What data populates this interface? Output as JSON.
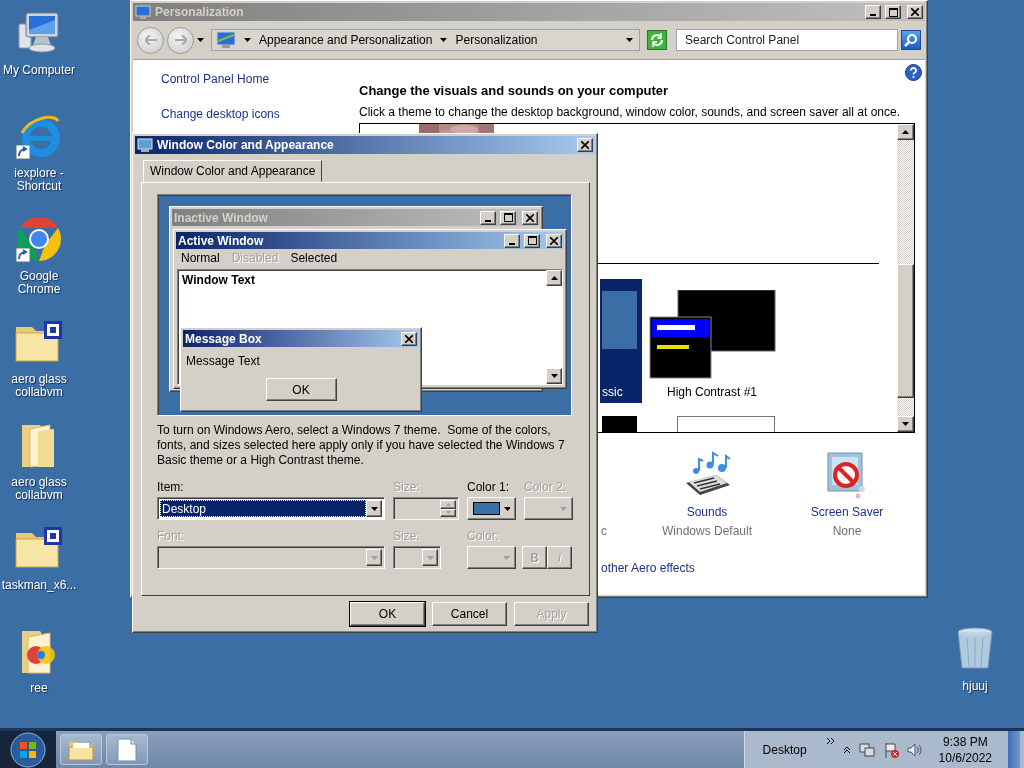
{
  "desktop_icons": [
    {
      "label": "My Computer",
      "kind": "computer",
      "shortcut": false
    },
    {
      "label": "iexplore - Shortcut",
      "kind": "browser_e",
      "shortcut": true
    },
    {
      "label": "Google Chrome",
      "kind": "browser_ring",
      "shortcut": true
    },
    {
      "label": "aero glass collabvm",
      "kind": "archive_seven",
      "shortcut": false
    },
    {
      "label": "aero glass collabvm",
      "kind": "folder",
      "shortcut": false
    },
    {
      "label": "taskman_x6...",
      "kind": "archive_zip",
      "shortcut": false
    },
    {
      "label": "ree",
      "kind": "folder_media",
      "shortcut": false
    }
  ],
  "recycle_bin": {
    "label": "hjuuj"
  },
  "personalization": {
    "title": "Personalization",
    "active": false,
    "breadcrumbs": [
      "Appearance and Personalization",
      "Personalization"
    ],
    "search": {
      "placeholder": "Search Control Panel"
    },
    "sidebar": [
      "Control Panel Home",
      "Change desktop icons"
    ],
    "heading": "Change the visuals and sounds on your computer",
    "description": "Click a theme to change the desktop background, window color, sounds, and screen saver all at once.",
    "themes": [
      {
        "label": "ssic",
        "kind": "classic",
        "selected": true
      },
      {
        "label": "High Contrast #1",
        "kind": "high_contrast",
        "selected": false
      }
    ],
    "settings": [
      {
        "kind": "window_color",
        "subtitle": "c"
      },
      {
        "kind": "sounds",
        "title": "Sounds",
        "subtitle": "Windows Default"
      },
      {
        "kind": "screen_saver",
        "title": "Screen Saver",
        "subtitle": "None"
      }
    ],
    "link": "other Aero effects"
  },
  "dialog": {
    "title": "Window Color and Appearance",
    "active": true,
    "tabs": [
      {
        "label": "Window Color and Appearance",
        "selected": true
      }
    ],
    "preview": {
      "inactive_title": "Inactive Window",
      "active_title": "Active Window",
      "menu": [
        {
          "label": "Normal",
          "disabled": false
        },
        {
          "label": "Disabled",
          "disabled": true
        },
        {
          "label": "Selected",
          "disabled": false
        }
      ],
      "window_text": "Window Text",
      "message_box": {
        "title": "Message Box",
        "text": "Message Text",
        "button": "OK"
      }
    },
    "note": "To turn on Windows Aero, select a Windows 7 theme.  Some of the colors, fonts, and sizes selected here apply only if you have selected the Windows 7 Basic theme or a High Contrast theme.",
    "item_row": [
      {
        "kind": "select",
        "label": "Item:",
        "value": "Desktop",
        "focused": true,
        "disabled": false
      },
      {
        "kind": "spinner",
        "label": "Size:",
        "disabled": true
      },
      {
        "kind": "color",
        "label": "Color 1:",
        "color": "#3a6ea5",
        "disabled": false
      },
      {
        "kind": "color",
        "label": "Color 2:",
        "disabled": true
      }
    ],
    "font_row": [
      {
        "kind": "select",
        "label": "Font:",
        "disabled": true
      },
      {
        "kind": "dropdown",
        "label": "Size:",
        "disabled": true
      },
      {
        "kind": "color",
        "label": "Color:",
        "disabled": true
      },
      {
        "kind": "style_buttons",
        "buttons": [
          "B",
          "I"
        ],
        "disabled": true
      }
    ],
    "buttons": [
      {
        "label": "OK",
        "default": true,
        "disabled": false
      },
      {
        "label": "Cancel",
        "default": false,
        "disabled": false
      },
      {
        "label": "Apply",
        "default": false,
        "disabled": true
      }
    ]
  },
  "taskbar": {
    "tasks": [
      {
        "kind": "folder"
      },
      {
        "kind": "document"
      }
    ],
    "toolbar": "Desktop",
    "time": "9:38 PM",
    "date": "10/6/2022"
  }
}
